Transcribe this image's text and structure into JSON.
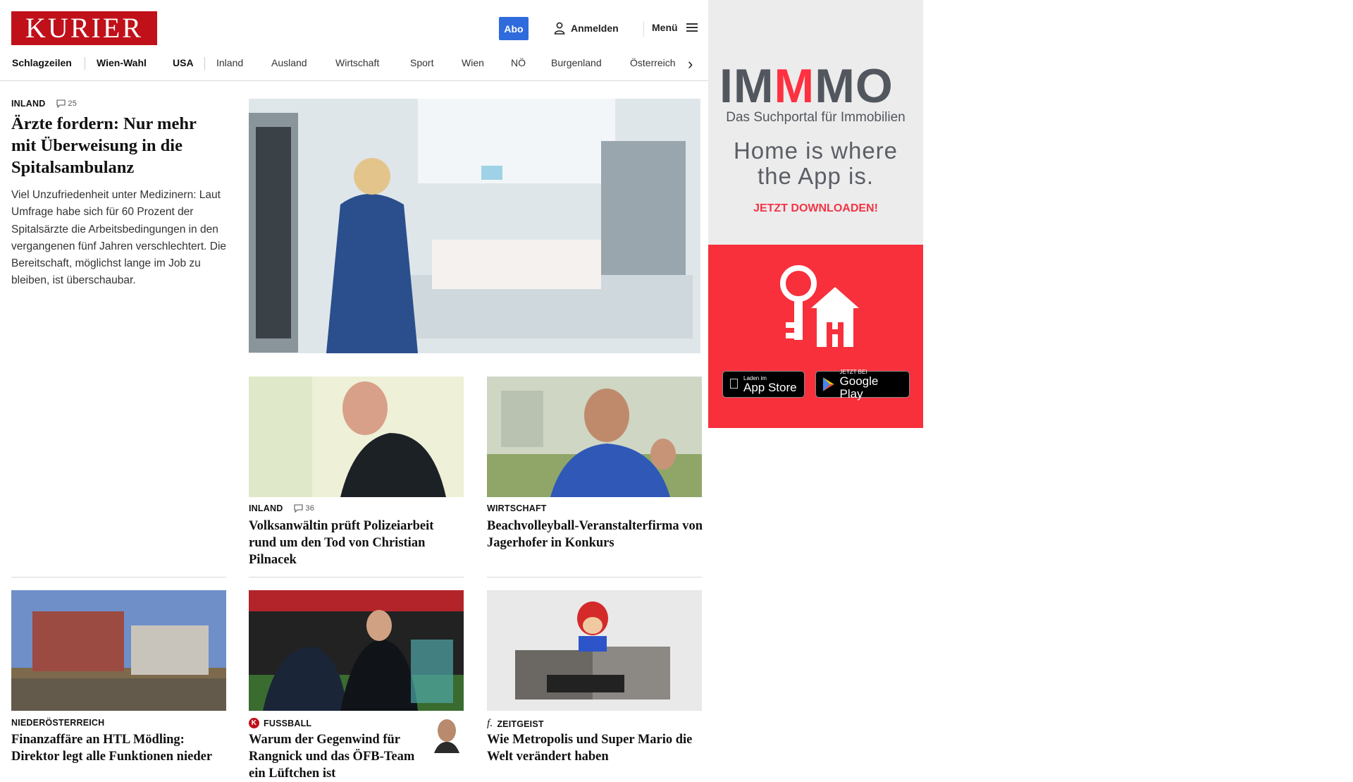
{
  "brand": {
    "logo_text": "KURIER",
    "logo_color": "#c0101a"
  },
  "header": {
    "abo_label": "Abo",
    "login_label": "Anmelden",
    "menu_label": "Menü",
    "abo_color": "#2f6bdc"
  },
  "nav": {
    "items": [
      "Schlagzeilen",
      "Wien-Wahl",
      "USA",
      "Inland",
      "Ausland",
      "Wirtschaft",
      "Sport",
      "Wien",
      "NÖ",
      "Burgenland",
      "Österreich"
    ]
  },
  "hero": {
    "category": "INLAND",
    "comments": "25",
    "title": "Ärzte fordern: Nur mehr mit Überweisung in die Spitalsambulanz",
    "lead": "Viel Unzufriedenheit unter Medizinern: Laut Umfrage habe sich für 60 Prozent der Spitalsärzte die Arbeitsbedingungen in den vergangenen fünf Jahren verschlechtert. Die Bereitschaft, möglichst lange im Job zu bleiben, ist überschaubar."
  },
  "articles": [
    {
      "category": "INLAND",
      "comments": "36",
      "title": "Volksanwältin prüft Polizeiarbeit rund um den Tod von Christian Pilnacek"
    },
    {
      "category": "WIRTSCHAFT",
      "title": "Beachvolleyball-Veranstalterfirma von Jagerhofer in Konkurs"
    },
    {
      "category": "NIEDERÖSTERREICH",
      "title": "Finanzaffäre an HTL Mödling: Direktor legt alle Funktionen nieder"
    },
    {
      "category": "FUSSBALL",
      "title": "Warum der Gegenwind für Rangnick und das ÖFB-Team ein Lüftchen ist"
    },
    {
      "category": "ZEITGEIST",
      "title": "Wie Metropolis und Super Mario die Welt verändert haben"
    }
  ],
  "ad": {
    "brand": [
      "IM",
      "M",
      "MO"
    ],
    "subtitle": "Das Suchportal für Immobilien",
    "headline_1": "Home is where",
    "headline_2": "the App is.",
    "cta": "JETZT DOWNLOADEN!",
    "appstore_small": "Laden im",
    "appstore_big": "App Store",
    "googleplay_small": "JETZT BEI",
    "googleplay_big": "Google Play",
    "accent_color": "#f7303c"
  }
}
